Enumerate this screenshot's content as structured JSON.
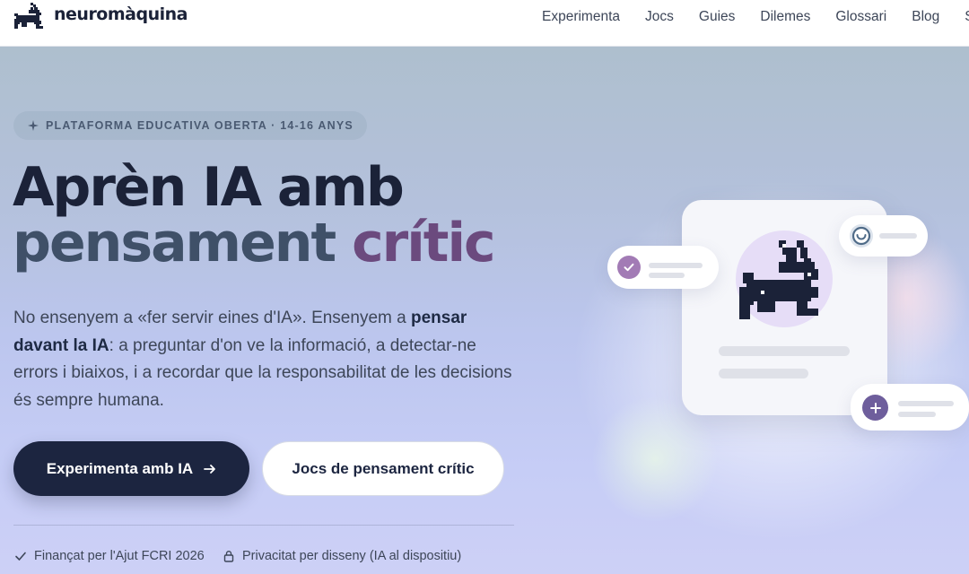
{
  "header": {
    "brand": "neuromàquina",
    "nav": [
      "Experimenta",
      "Jocs",
      "Guies",
      "Dilemes",
      "Glossari",
      "Blog",
      "S"
    ]
  },
  "hero": {
    "badge": "PLATAFORMA EDUCATIVA OBERTA · 14-16 ANYS",
    "title_line1": "Aprèn IA amb",
    "title_word1": "pensament",
    "title_word2": "crític",
    "lead": {
      "part1": "No ensenyem a «fer servir eines d'IA». Ensenyem a ",
      "bold": "pensar davant la IA",
      "part2": ": a preguntar d'on ve la informació, a detectar-ne errors i biaixos, i a recordar que la responsabilitat de les decisions és sempre humana."
    },
    "primary_button": "Experimenta amb IA",
    "secondary_button": "Jocs de pensament crític",
    "trust": [
      {
        "icon": "check-icon",
        "text": "Finançat per l'Ajut FCRI 2026"
      },
      {
        "icon": "lock-icon",
        "text": "Privacitat per disseny (IA al dispositiu)"
      }
    ]
  },
  "illustration": {
    "icons": [
      "rabbit-icon",
      "check-circle-icon",
      "smile-icon",
      "plus-circle-icon"
    ],
    "colors": {
      "accent_purple": "#a27bb5",
      "accent_violet": "#6e5e9c",
      "accent_teal": "#4f6b88",
      "dark": "#1b2238"
    }
  },
  "colors": {
    "primary_button": "#1c2540",
    "title_word1": "#3f5068",
    "title_word2": "#6b4a7e"
  }
}
